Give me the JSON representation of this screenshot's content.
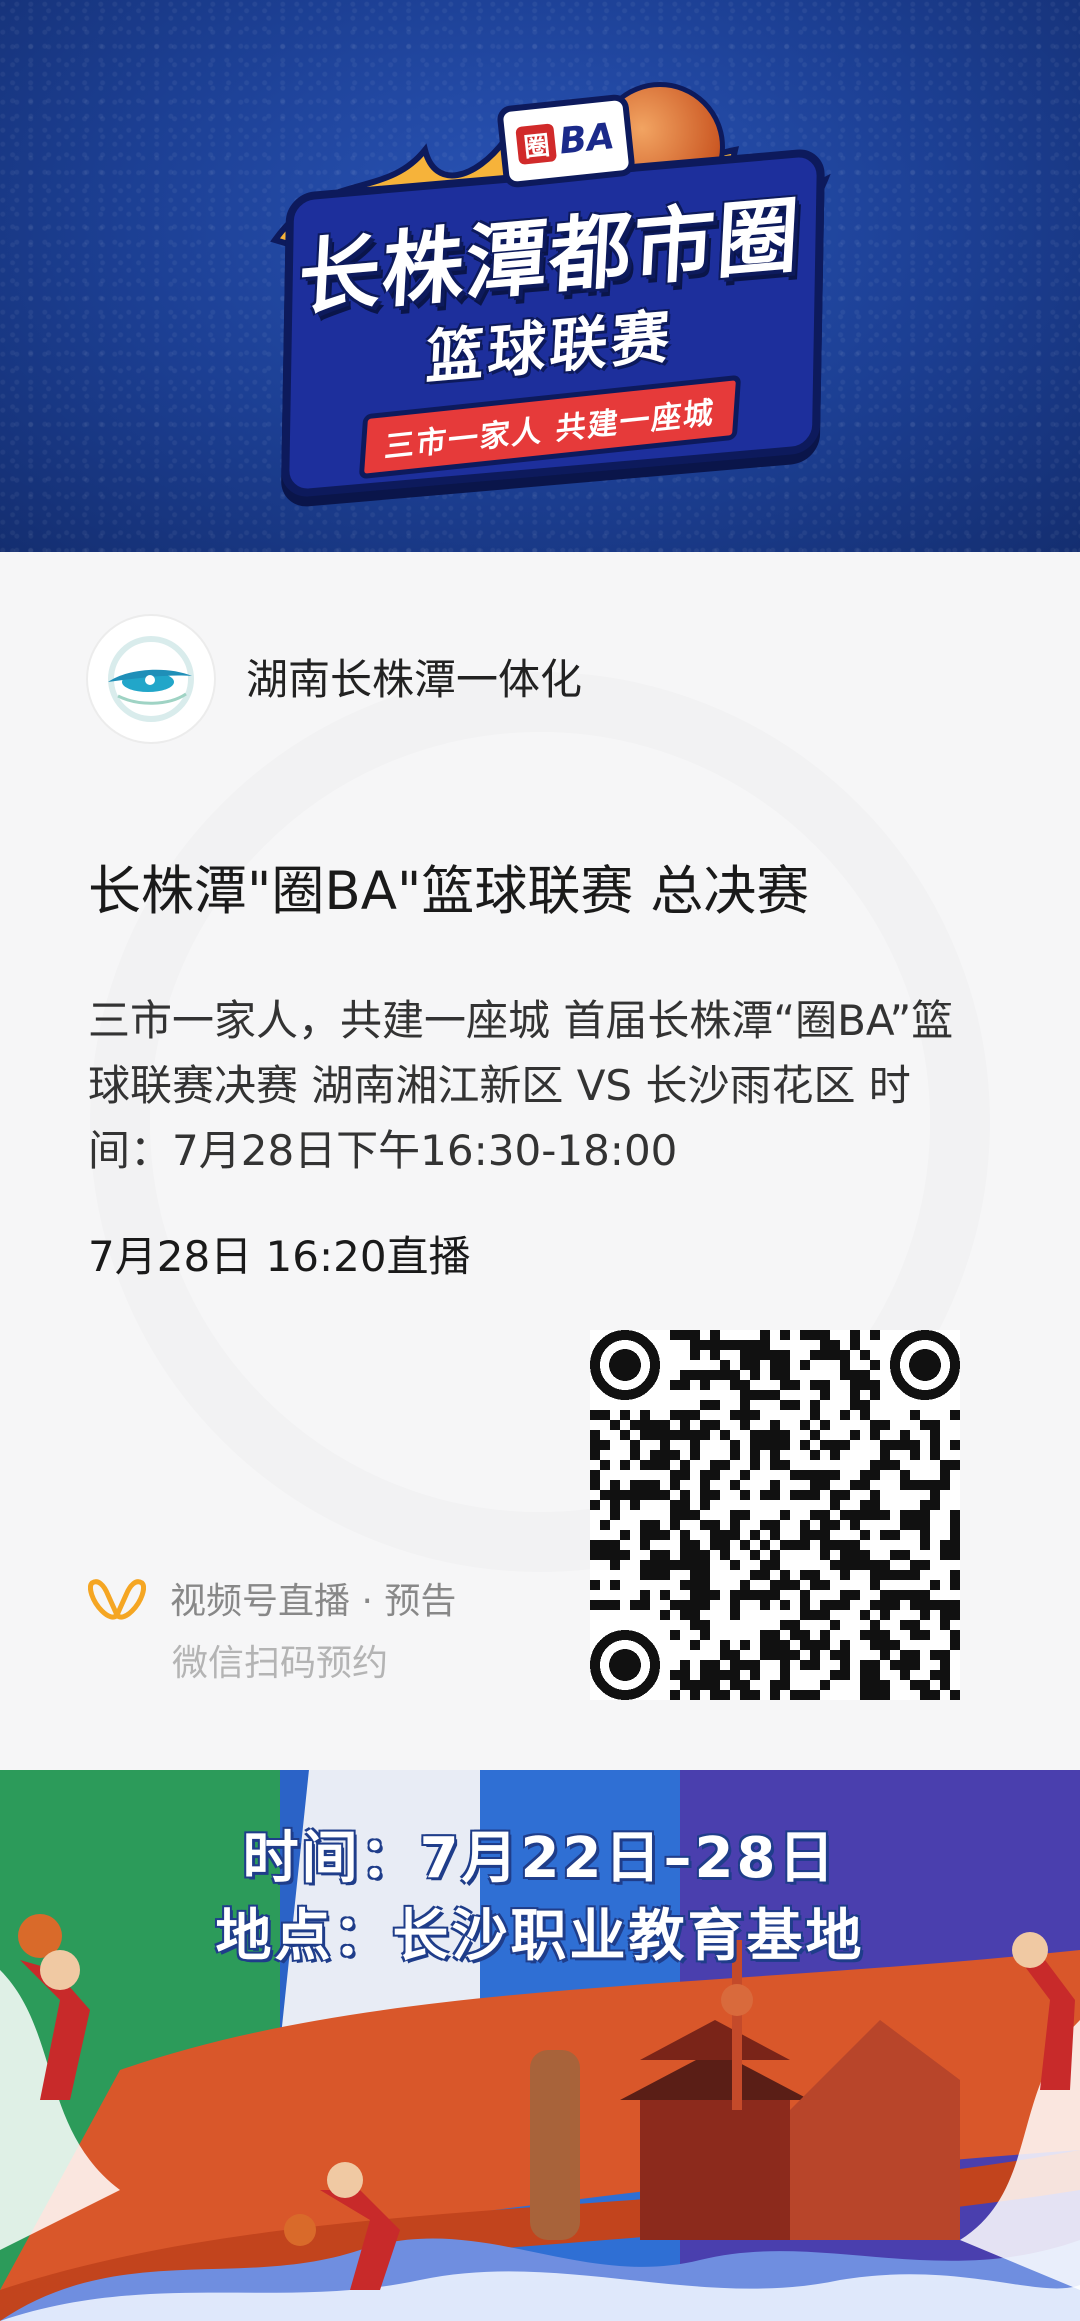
{
  "banner": {
    "logo_badge_left": "圈",
    "logo_badge_right": "BA",
    "logo_title_line1": "长株潭都市圈",
    "logo_title_line2": "篮球联赛",
    "logo_slogan": "三市一家人 共建一座城",
    "colors": {
      "background": "#1c3f93",
      "ribbon": "#e63a3a",
      "outline": "#0d1a5c"
    }
  },
  "card": {
    "account_name": "湖南长株潭一体化",
    "live_title": "长株潭\"圈BA\"篮球联赛 总决赛",
    "description": "三市一家人，共建一座城 首届长株潭“圈BA”篮球联赛决赛 湖南湘江新区 VS 长沙雨花区 时间：7月28日下午16:30-18:00",
    "live_time": "7月28日 16:20直播",
    "channels_label": "视频号直播 · 预告",
    "scan_hint": "微信扫码预约",
    "icons": {
      "channels": "wechat-channels-icon",
      "qr": "qr-code"
    },
    "colors": {
      "channels_icon": "#f5a623",
      "background": "#f6f6f7"
    }
  },
  "event": {
    "time_line": "时间：7月22日–28日",
    "place_line": "地点：长沙职业教育基地"
  }
}
